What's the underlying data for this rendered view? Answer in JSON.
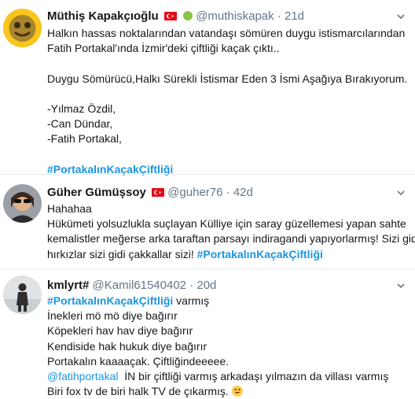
{
  "tweets": [
    {
      "name": "Müthiş Kapakçıoğlu",
      "handle": "@muthiskapak",
      "sep": "·",
      "time": "21d",
      "lines": [
        "Halkın hassas noktalarından vatandaşı sömüren duygu istismarcılarından",
        "Fatih Portakal'ında İzmir'deki çiftliği kaçak çıktı..",
        "",
        "Duygu Sömürücü,Halkı Sürekli İstismar Eden 3 İsmi Aşağıya Bırakıyorum.",
        "",
        "-Yılmaz Özdil,",
        "-Can Dündar,",
        "-Fatih Portakal,",
        ""
      ],
      "hashtag": "#PortakalınKaçakÇiftliği"
    },
    {
      "name": "Güher Gümüşsoy",
      "handle": "@guher76",
      "sep": "·",
      "time": "42d",
      "lines": [
        "Hahahaa",
        "Hükümeti yolsuzlukla suçlayan Külliye için saray güzellemesi yapan sahte",
        "kemalistler meğerse arka taraftan parsayı indiragandi yapıyorlarmış! Sizi gidi"
      ],
      "last_line_prefix": "hırkızlar sizi gidi çakkallar sizi!",
      "hashtag": "#PortakalınKaçakÇiftliği"
    },
    {
      "name": "kmlyrt#",
      "handle": "@Kamil61540402",
      "sep": "·",
      "time": "20d",
      "first_hashtag": "#PortakalınKaçakÇiftliği",
      "first_line_rest": " varmış",
      "lines": [
        "İnekleri mö mö diye bağırır",
        "Köpekleri hav hav diye bağırır",
        "Kendiside hak hukuk diye bağırır",
        "Portakalın kaaaaçak. Çiftliğindeeeee."
      ],
      "mention": "@fatihportakal",
      "mention_rest": "  İN bir çiftliği varmış arkadaşı yılmazın da villası varmış",
      "last_line": "Biri fox tv de biri halk TV de çıkarmış."
    }
  ],
  "colors": {
    "link": "#1b95e0",
    "muted": "#657786",
    "divider": "#e6ecf0",
    "flag": "#e30a17"
  },
  "icons": [
    "chevron-down-icon",
    "turkey-flag-icon",
    "green-dot-icon",
    "grinning-emoji-icon"
  ]
}
